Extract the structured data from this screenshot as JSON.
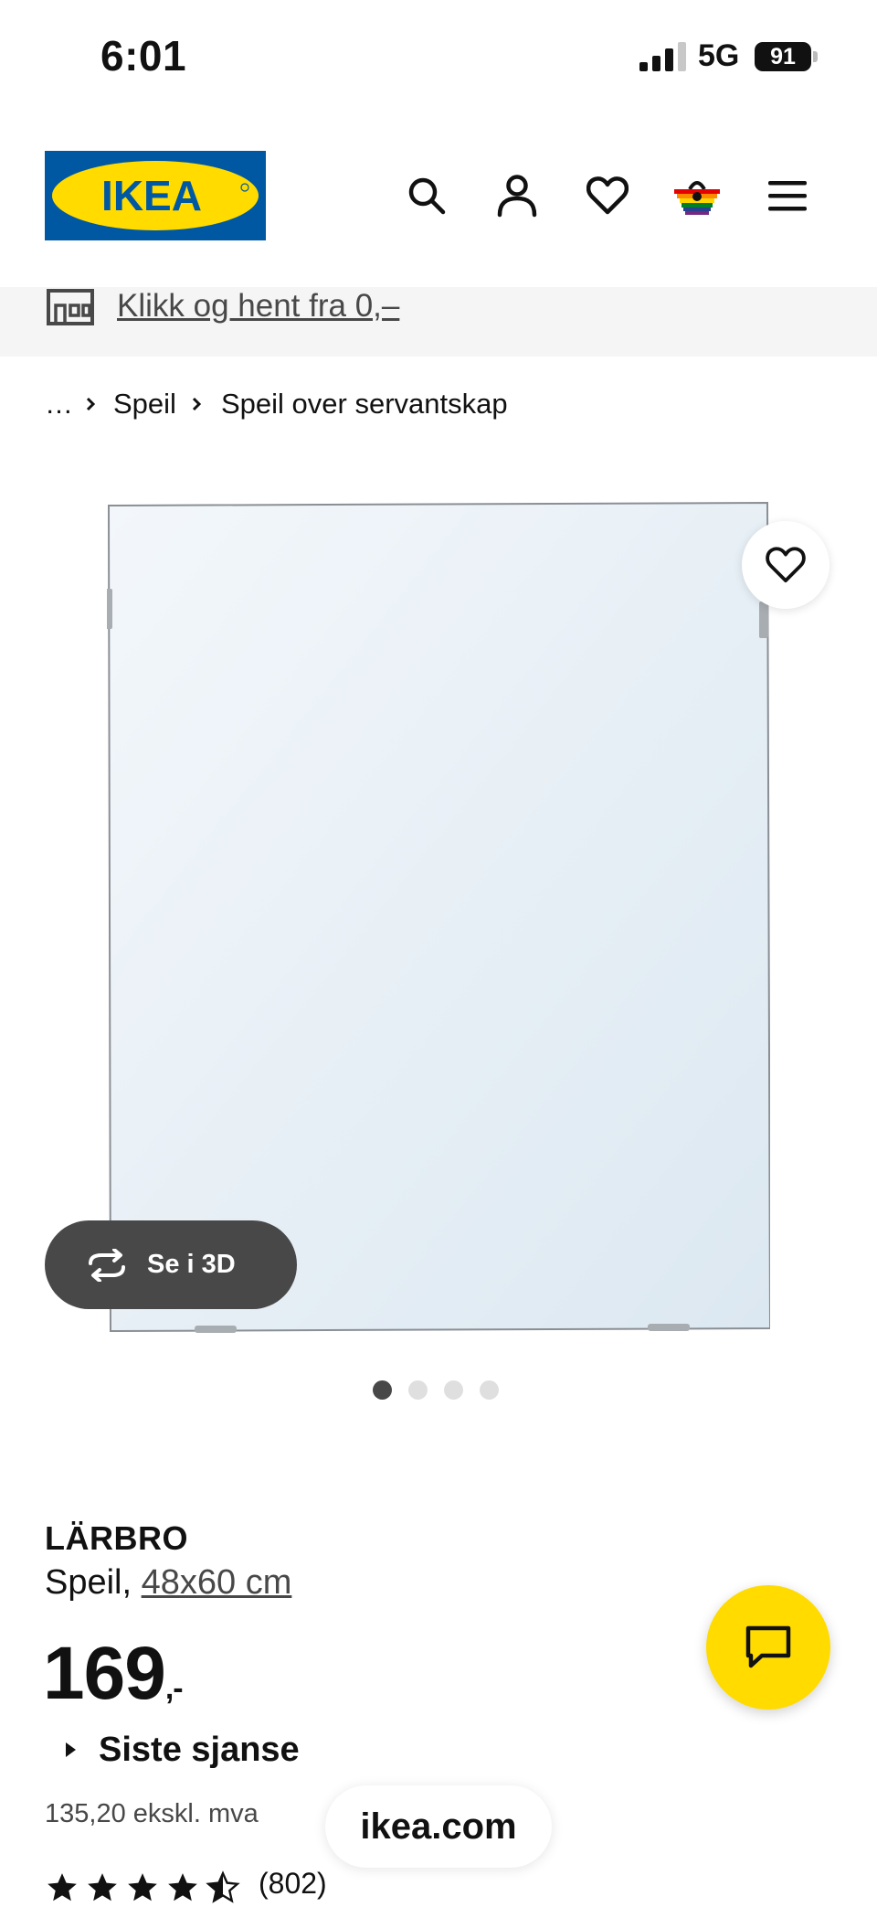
{
  "status_bar": {
    "time": "6:01",
    "network": "5G",
    "battery": "91"
  },
  "header": {
    "logo_text": "IKEA",
    "brand_colors": {
      "blue": "#0058a3",
      "yellow": "#ffdb00"
    },
    "icons": [
      "search-icon",
      "account-icon",
      "heart-icon",
      "cart-icon",
      "menu-icon"
    ]
  },
  "promo": {
    "icon": "store-icon",
    "link_text": "Klikk og hent fra 0,–"
  },
  "breadcrumb": {
    "ellipsis": "…",
    "items": [
      "Speil",
      "Speil over servantskap"
    ]
  },
  "gallery": {
    "button_3d": "Se i 3D",
    "image_count": 4,
    "active_index": 0
  },
  "product": {
    "name": "LÄRBRO",
    "type": "Speil,",
    "size": "48x60 cm",
    "price": "169",
    "price_suffix": ",-",
    "status": "Siste sjanse",
    "price_ex_vat": "135,20 ekskl. mva",
    "rating": 4.5,
    "review_count": "(802)"
  },
  "browser": {
    "url": "ikea.com"
  },
  "chat": {
    "icon": "chat-icon",
    "accent": "#ffdb00"
  }
}
